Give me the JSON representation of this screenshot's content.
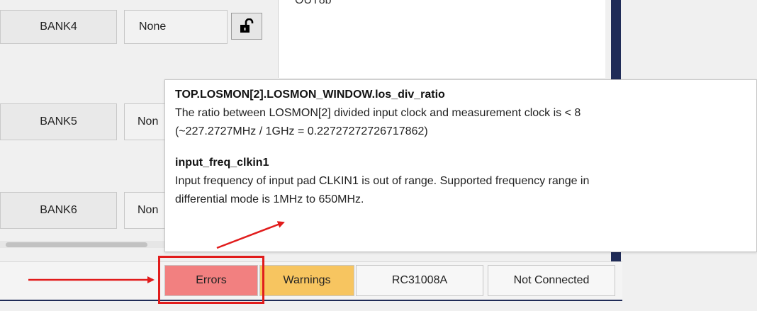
{
  "banks": [
    {
      "label": "BANK4",
      "value": "None"
    },
    {
      "label": "BANK5",
      "value": "Non"
    },
    {
      "label": "BANK6",
      "value": "Non"
    }
  ],
  "panel": {
    "clipped_text": "OUT8b"
  },
  "tooltip": {
    "entry1_title": "TOP.LOSMON[2].LOSMON_WINDOW.los_div_ratio",
    "entry1_line1": "The ratio between LOSMON[2] divided input clock and measurement clock is < 8",
    "entry1_line2": "(~227.2727MHz / 1GHz = 0.22727272726717862)",
    "entry2_title": "input_freq_clkin1",
    "entry2_line1": "Input frequency of input pad CLKIN1 is out of range. Supported frequency range in",
    "entry2_line2": "differential mode is 1MHz to 650MHz."
  },
  "statusbar": {
    "errors": "Errors",
    "warnings": "Warnings",
    "device": "RC31008A",
    "connection": "Not Connected"
  },
  "colors": {
    "errors_bg": "#f28080",
    "warnings_bg": "#f7c560",
    "annotation_red": "#e11c1c",
    "navy": "#1f2b57"
  }
}
